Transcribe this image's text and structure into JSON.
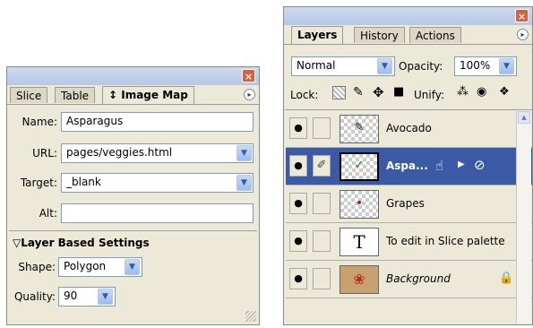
{
  "image_map_panel": {
    "close_glyph": "×",
    "tabs": [
      {
        "label": "Slice"
      },
      {
        "label": "Table"
      },
      {
        "label": "↕ Image Map"
      }
    ],
    "menu_glyph": "▸",
    "fields": {
      "name_label": "Name:",
      "name_value": "Asparagus",
      "url_label": "URL:",
      "url_value": "pages/veggies.html",
      "target_label": "Target:",
      "target_value": "_blank",
      "alt_label": "Alt:",
      "alt_value": ""
    },
    "section_title": "▽Layer Based Settings",
    "shape_label": "Shape:",
    "shape_value": "Polygon",
    "quality_label": "Quality:",
    "quality_value": "90"
  },
  "layers_panel": {
    "close_glyph": "×",
    "tabs": [
      {
        "label": "Layers"
      },
      {
        "label": "History"
      },
      {
        "label": "Actions"
      }
    ],
    "menu_glyph": "▸",
    "blend_mode": "Normal",
    "opacity_label": "Opacity:",
    "opacity_value": "100%",
    "lock_label": "Lock:",
    "unify_label": "Unify:",
    "layers": [
      {
        "name": "Avocado",
        "eye": "●",
        "link": "",
        "thumb_mark": "✎",
        "selected": false
      },
      {
        "name": "Aspa...",
        "eye": "●",
        "link": "✐",
        "thumb_mark": "✓",
        "selected": true
      },
      {
        "name": "Grapes",
        "eye": "●",
        "link": "",
        "thumb_mark": "•",
        "selected": false
      },
      {
        "name": "To edit in Slice palette",
        "eye": "●",
        "link": "",
        "thumb_mark": "T",
        "selected": false
      },
      {
        "name": "Background",
        "eye": "●",
        "link": "",
        "thumb_mark": "❀",
        "selected": false
      }
    ],
    "aspa_icons": {
      "hand": "☝",
      "play": "▶",
      "nolink": "⊘"
    },
    "lock_glyph": "🔒"
  },
  "colors": {
    "panel_bg": "#ece9d8",
    "selected_row": "#3a5aa6",
    "field_border": "#7f9db9"
  }
}
